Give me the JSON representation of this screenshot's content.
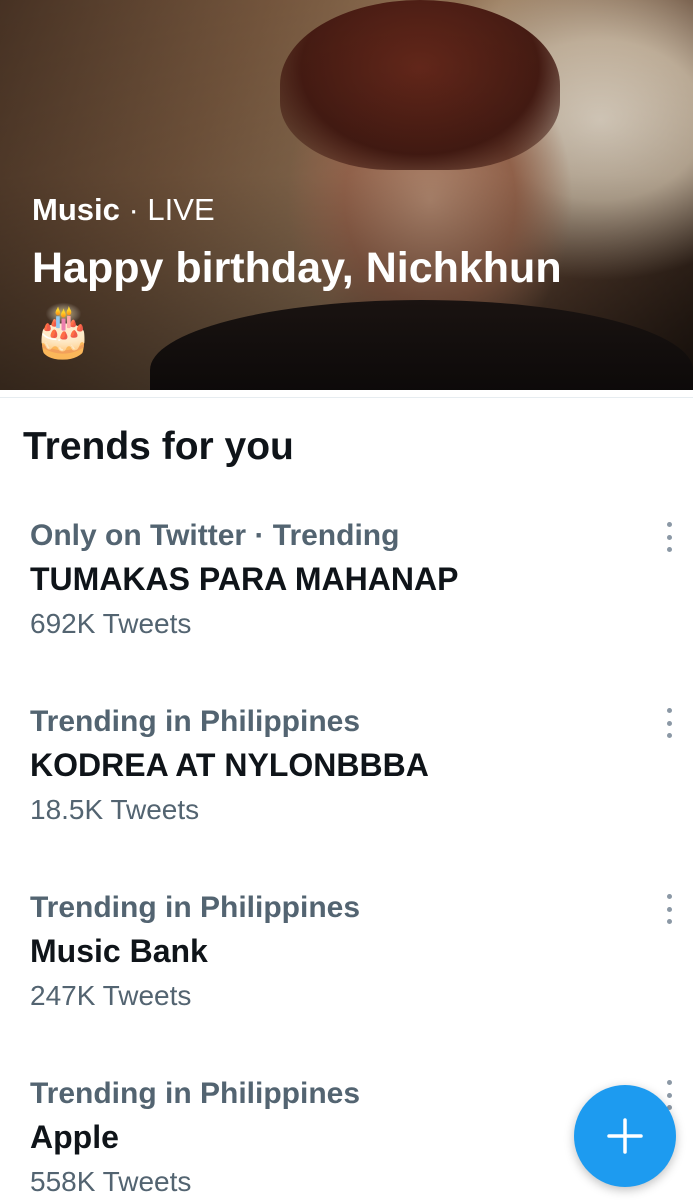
{
  "hero": {
    "category": "Music",
    "separator": " · ",
    "status": "LIVE",
    "title": "Happy birthday, Nichkhun",
    "emoji": "🎂"
  },
  "section": {
    "title": "Trends for you"
  },
  "trends": [
    {
      "context": "Only on Twitter · Trending",
      "name": "TUMAKAS PARA MAHANAP",
      "count": "692K Tweets"
    },
    {
      "context": "Trending in Philippines",
      "name": "KODREA AT NYLONBBBA",
      "count": "18.5K Tweets"
    },
    {
      "context": "Trending in Philippines",
      "name": "Music Bank",
      "count": "247K Tweets"
    },
    {
      "context": "Trending in Philippines",
      "name": "Apple",
      "count": "558K Tweets"
    }
  ],
  "icons": {
    "more": "more-vertical-icon",
    "compose": "plus-icon"
  },
  "colors": {
    "accent": "#1d9bf0",
    "secondary_text": "#536471",
    "primary_text": "#0f1419"
  }
}
